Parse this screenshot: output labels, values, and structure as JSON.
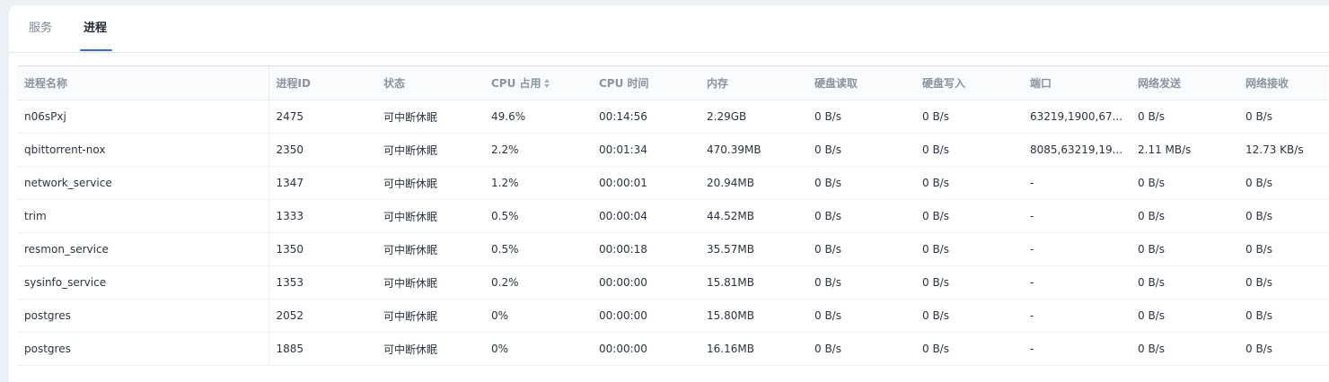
{
  "tabs": [
    {
      "label": "服务",
      "active": false
    },
    {
      "label": "进程",
      "active": true
    }
  ],
  "colors": {
    "accent": "#2d6ee6",
    "header_text": "#8a93a2",
    "cell_text": "#2b3340"
  },
  "table": {
    "sorted_column": "cpu",
    "sort_icon": "sort-caret-icon",
    "columns": [
      {
        "key": "name",
        "label": "进程名称"
      },
      {
        "key": "pid",
        "label": "进程ID"
      },
      {
        "key": "status",
        "label": "状态"
      },
      {
        "key": "cpu",
        "label": "CPU 占用"
      },
      {
        "key": "cpu_time",
        "label": "CPU 时间"
      },
      {
        "key": "memory",
        "label": "内存"
      },
      {
        "key": "disk_read",
        "label": "硬盘读取"
      },
      {
        "key": "disk_write",
        "label": "硬盘写入"
      },
      {
        "key": "ports",
        "label": "端口"
      },
      {
        "key": "net_send",
        "label": "网络发送"
      },
      {
        "key": "net_recv",
        "label": "网络接收"
      }
    ],
    "rows": [
      {
        "name": "n06sPxj",
        "pid": "2475",
        "status": "可中断休眠",
        "cpu": "49.6%",
        "cpu_time": "00:14:56",
        "memory": "2.29GB",
        "disk_read": "0 B/s",
        "disk_write": "0 B/s",
        "ports": "63219,1900,67...",
        "net_send": "0 B/s",
        "net_recv": "0 B/s"
      },
      {
        "name": "qbittorrent-nox",
        "pid": "2350",
        "status": "可中断休眠",
        "cpu": "2.2%",
        "cpu_time": "00:01:34",
        "memory": "470.39MB",
        "disk_read": "0 B/s",
        "disk_write": "0 B/s",
        "ports": "8085,63219,19...",
        "net_send": "2.11 MB/s",
        "net_recv": "12.73 KB/s"
      },
      {
        "name": "network_service",
        "pid": "1347",
        "status": "可中断休眠",
        "cpu": "1.2%",
        "cpu_time": "00:00:01",
        "memory": "20.94MB",
        "disk_read": "0 B/s",
        "disk_write": "0 B/s",
        "ports": "-",
        "net_send": "0 B/s",
        "net_recv": "0 B/s"
      },
      {
        "name": "trim",
        "pid": "1333",
        "status": "可中断休眠",
        "cpu": "0.5%",
        "cpu_time": "00:00:04",
        "memory": "44.52MB",
        "disk_read": "0 B/s",
        "disk_write": "0 B/s",
        "ports": "-",
        "net_send": "0 B/s",
        "net_recv": "0 B/s"
      },
      {
        "name": "resmon_service",
        "pid": "1350",
        "status": "可中断休眠",
        "cpu": "0.5%",
        "cpu_time": "00:00:18",
        "memory": "35.57MB",
        "disk_read": "0 B/s",
        "disk_write": "0 B/s",
        "ports": "-",
        "net_send": "0 B/s",
        "net_recv": "0 B/s"
      },
      {
        "name": "sysinfo_service",
        "pid": "1353",
        "status": "可中断休眠",
        "cpu": "0.2%",
        "cpu_time": "00:00:00",
        "memory": "15.81MB",
        "disk_read": "0 B/s",
        "disk_write": "0 B/s",
        "ports": "-",
        "net_send": "0 B/s",
        "net_recv": "0 B/s"
      },
      {
        "name": "postgres",
        "pid": "2052",
        "status": "可中断休眠",
        "cpu": "0%",
        "cpu_time": "00:00:00",
        "memory": "15.80MB",
        "disk_read": "0 B/s",
        "disk_write": "0 B/s",
        "ports": "-",
        "net_send": "0 B/s",
        "net_recv": "0 B/s"
      },
      {
        "name": "postgres",
        "pid": "1885",
        "status": "可中断休眠",
        "cpu": "0%",
        "cpu_time": "00:00:00",
        "memory": "16.16MB",
        "disk_read": "0 B/s",
        "disk_write": "0 B/s",
        "ports": "-",
        "net_send": "0 B/s",
        "net_recv": "0 B/s"
      }
    ]
  }
}
